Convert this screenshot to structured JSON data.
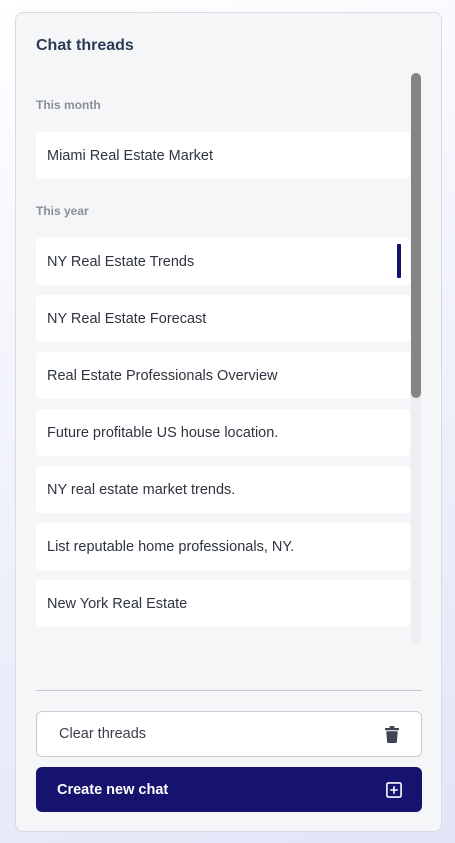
{
  "panel": {
    "title": "Chat threads"
  },
  "sections": [
    {
      "label": "This month",
      "threads": [
        {
          "label": "Miami Real Estate Market"
        }
      ]
    },
    {
      "label": "This year",
      "threads": [
        {
          "label": "NY Real Estate Trends",
          "active": true
        },
        {
          "label": "NY Real Estate Forecast"
        },
        {
          "label": "Real Estate Professionals Overview"
        },
        {
          "label": "Future profitable US house location."
        },
        {
          "label": "NY real estate market trends."
        },
        {
          "label": "List reputable home professionals, NY."
        },
        {
          "label": "New York Real Estate"
        }
      ]
    }
  ],
  "actions": {
    "clear_label": "Clear threads",
    "clear_icon": "trash-icon",
    "create_label": "Create new chat",
    "create_icon": "plus-square-icon"
  },
  "colors": {
    "accent": "#16136f",
    "active_marker": "#14126f",
    "panel_bg": "#f5f6f8"
  }
}
